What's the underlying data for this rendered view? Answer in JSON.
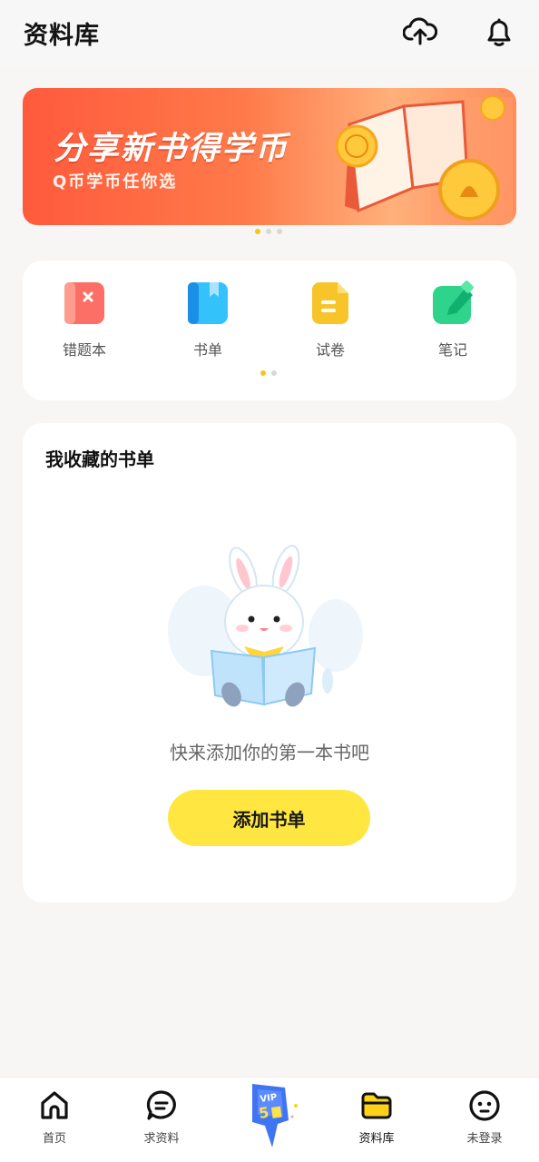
{
  "header": {
    "title": "资料库",
    "upload_icon": "cloud-upload-icon",
    "bell_icon": "bell-icon"
  },
  "banner": {
    "title": "分享新书得学币",
    "subtitle": "Q币学币任你选",
    "page_count": 3,
    "active_page": 1
  },
  "quick_access": {
    "items": [
      {
        "label": "错题本",
        "icon": "mistake-book-icon",
        "color": "#fb6f66"
      },
      {
        "label": "书单",
        "icon": "book-list-icon",
        "color": "#2fb4f5"
      },
      {
        "label": "试卷",
        "icon": "exam-paper-icon",
        "color": "#f7c52a"
      },
      {
        "label": "笔记",
        "icon": "note-icon",
        "color": "#2ed48b"
      }
    ],
    "page_count": 2,
    "active_page": 1
  },
  "collection": {
    "title": "我收藏的书单",
    "empty_text": "快来添加你的第一本书吧",
    "add_button": "添加书单"
  },
  "tabbar": {
    "items": [
      {
        "label": "首页",
        "icon": "home-icon"
      },
      {
        "label": "求资料",
        "icon": "chat-bubble-icon"
      },
      {
        "label": "资料库",
        "icon": "folder-icon",
        "active": true
      },
      {
        "label": "未登录",
        "icon": "user-face-icon"
      }
    ],
    "promo_icon": "vip-discount-icon"
  },
  "colors": {
    "accent": "#ffe640",
    "banner": "#ff5a3c"
  }
}
